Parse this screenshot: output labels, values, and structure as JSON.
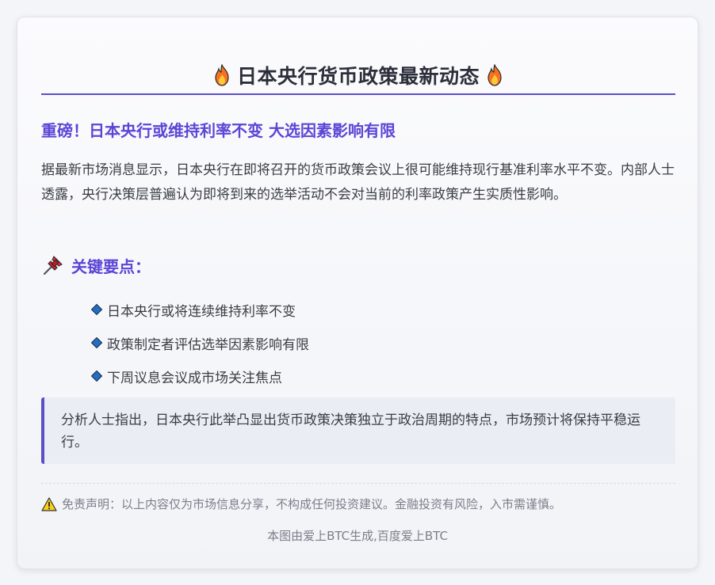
{
  "header": {
    "title": "日本央行货币政策最新动态",
    "left_icon": "fire-icon",
    "right_icon": "fire-icon"
  },
  "article": {
    "headline": "重磅！日本央行或维持利率不变 大选因素影响有限",
    "body": "据最新市场消息显示，日本央行在即将召开的货币政策会议上很可能维持现行基准利率水平不变。内部人士透露，央行决策层普遍认为即将到来的选举活动不会对当前的利率政策产生实质性影响。"
  },
  "key_points": {
    "icon": "pushpin-icon",
    "label": "关键要点：",
    "bullet_icon": "blue-diamond-icon",
    "items": [
      "日本央行或将连续维持利率不变",
      "政策制定者评估选举因素影响有限",
      "下周议息会议成市场关注焦点"
    ]
  },
  "analysis": {
    "quote": "分析人士指出，日本央行此举凸显出货币政策决策独立于政治周期的特点，市场预计将保持平稳运行。"
  },
  "disclaimer": {
    "icon": "warning-icon",
    "text": "免责声明：以上内容仅为市场信息分享，不构成任何投资建议。金融投资有风险，入市需谨慎。"
  },
  "footer": {
    "text": "本图由爱上BTC生成,百度爱上BTC"
  },
  "colors": {
    "accent": "#5b45d6",
    "border_accent": "#5b4fc9",
    "bullet_blue": "#1f6fc5",
    "background": "#f4f5f8"
  }
}
